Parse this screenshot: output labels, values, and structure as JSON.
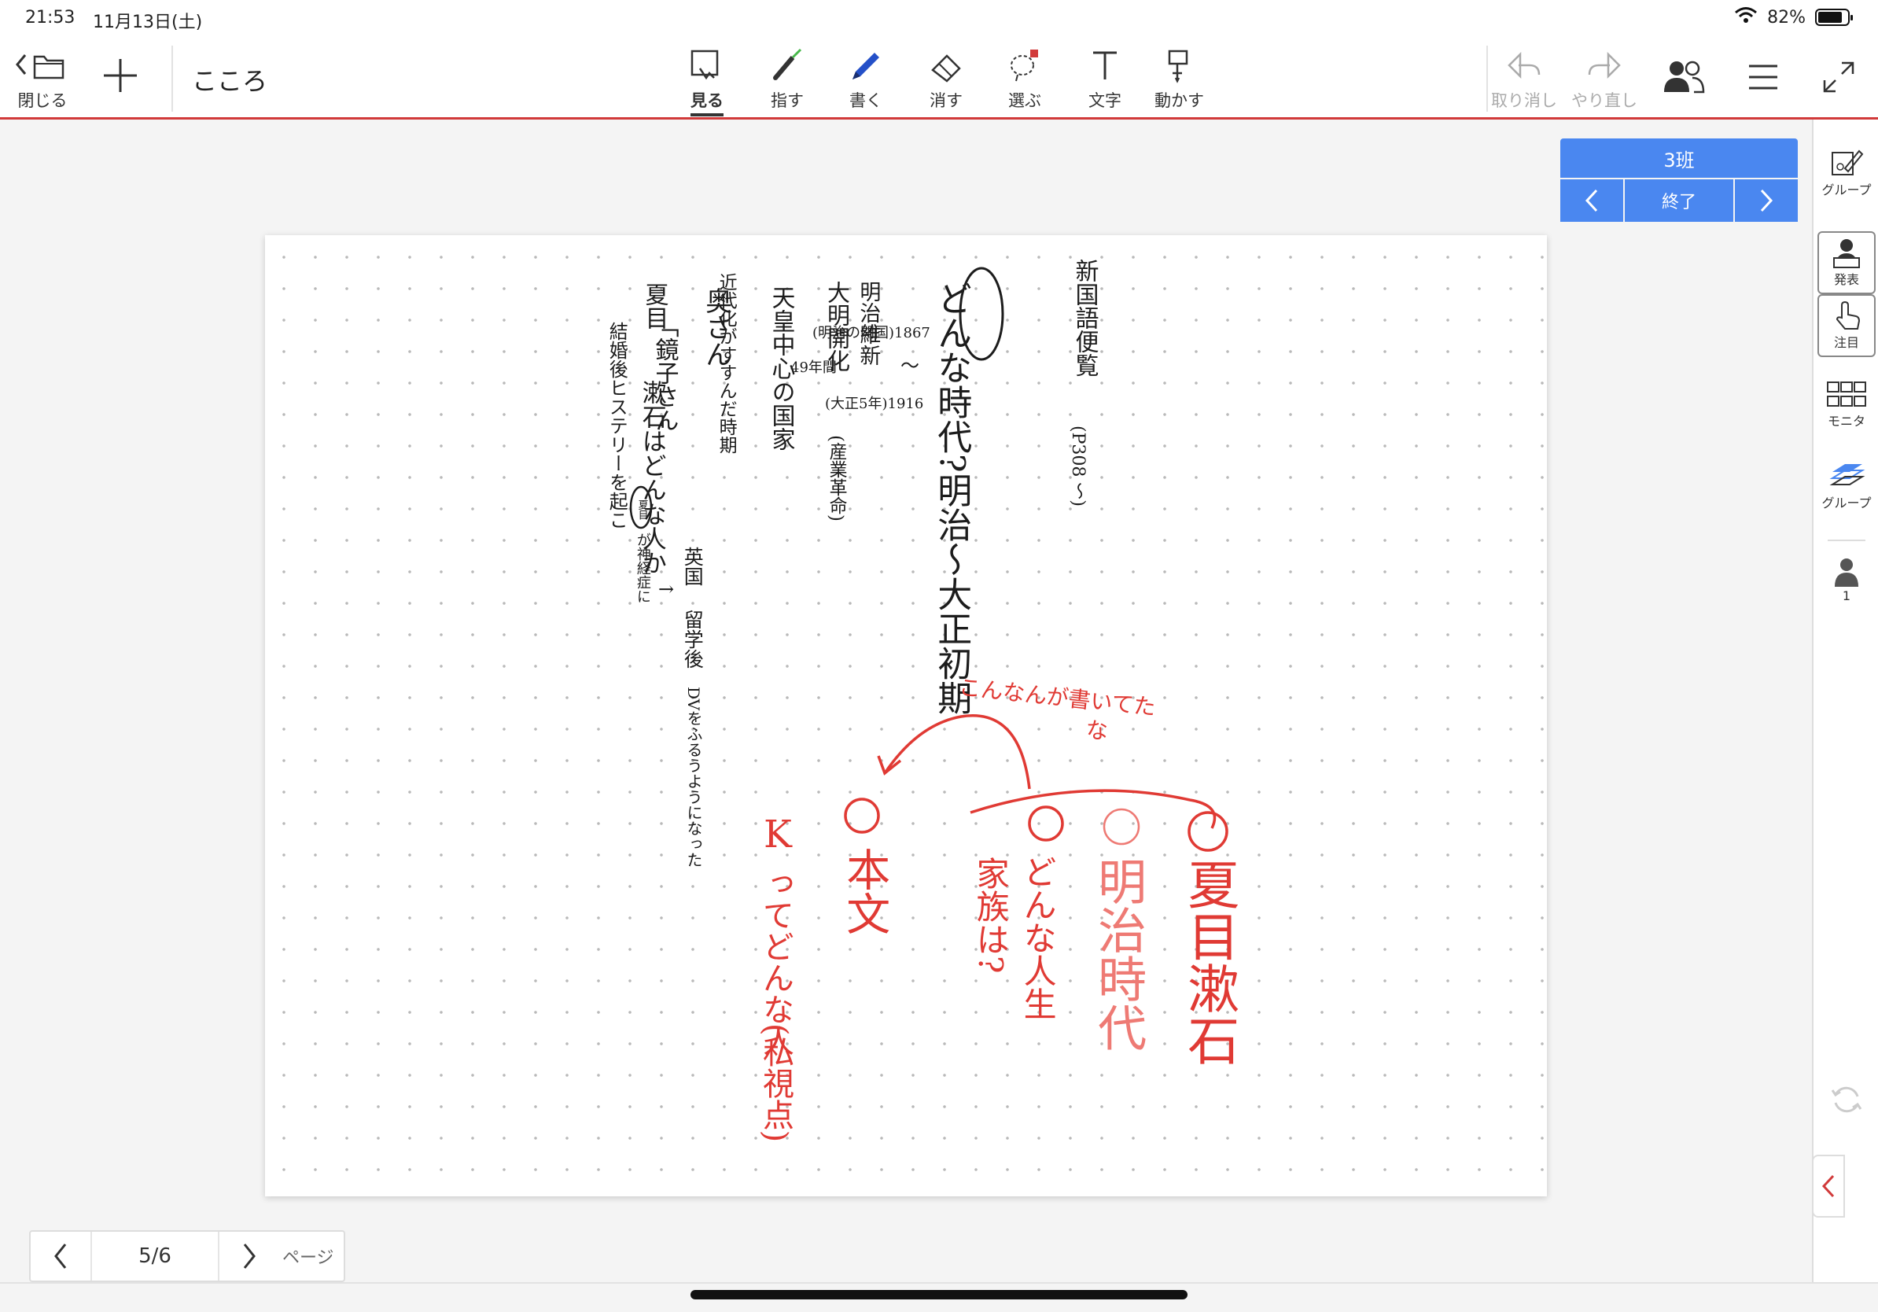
{
  "status_bar": {
    "time": "21:53",
    "date": "11月13日(土)",
    "battery": "82%",
    "battery_level": 0.82
  },
  "toolbar": {
    "close_label": "閉じる",
    "doc_title": "こころ",
    "tools": [
      {
        "label": "見る",
        "icon": "view-icon"
      },
      {
        "label": "指す",
        "icon": "laser-pointer-icon"
      },
      {
        "label": "書く",
        "icon": "pen-icon"
      },
      {
        "label": "消す",
        "icon": "eraser-icon"
      },
      {
        "label": "選ぶ",
        "icon": "lasso-select-icon"
      },
      {
        "label": "文字",
        "icon": "text-icon"
      },
      {
        "label": "動かす",
        "icon": "move-icon"
      }
    ],
    "undo_label": "取り消し",
    "redo_label": "やり直し",
    "accent_color": "#d13a3a"
  },
  "group_panel": {
    "name": "3班",
    "end_label": "終了",
    "color": "#4a87f0"
  },
  "sidebar": {
    "group_label": "グループ",
    "present_label": "発表",
    "attention_label": "注目",
    "monitor_label": "モニタ",
    "group2_label": "グループ",
    "user_count": "1"
  },
  "canvas": {
    "notes_black": {
      "col1": "新国語便覧",
      "col1_ref": "(P308 〜)",
      "col2": "どんな時代?明治〜大正初期",
      "col3a": "明治維新",
      "col3b": "大明開化",
      "col3c": "(産業革命)",
      "col4": "天皇中心の国家",
      "col5": "近代化がすすんだ時期",
      "col6a": "夏目",
      "col6b": "漱石はどんな人か",
      "date1": "(明治の開国)1867",
      "date2": "〜",
      "date3": "(大正5年)1916",
      "span": "49年間",
      "wife1": "奥さん",
      "wife2": "「鏡子さん",
      "marriage": "結婚後ヒステリーを起こ",
      "soseki_circled": "夏目",
      "nerve": "が神経症に",
      "arrow": "→",
      "uk1": "英国",
      "uk2": "留学後",
      "dv": "DVをふるうようになった"
    },
    "notes_red": {
      "note_top": "こんなんが書いてた",
      "note_top2": "な",
      "n1": "①",
      "n1_text": "夏目漱石",
      "n2": "②",
      "n2_text": "明治時代",
      "n3": "③",
      "n3_text_a": "どんな人生",
      "n3_text_b": "家族は?",
      "n4": "④",
      "n4_text": "本文",
      "k1": "K",
      "k2": "ってどんな人",
      "k3": "(私視点)"
    }
  },
  "pager": {
    "current": "5/6",
    "label": "ページ"
  }
}
